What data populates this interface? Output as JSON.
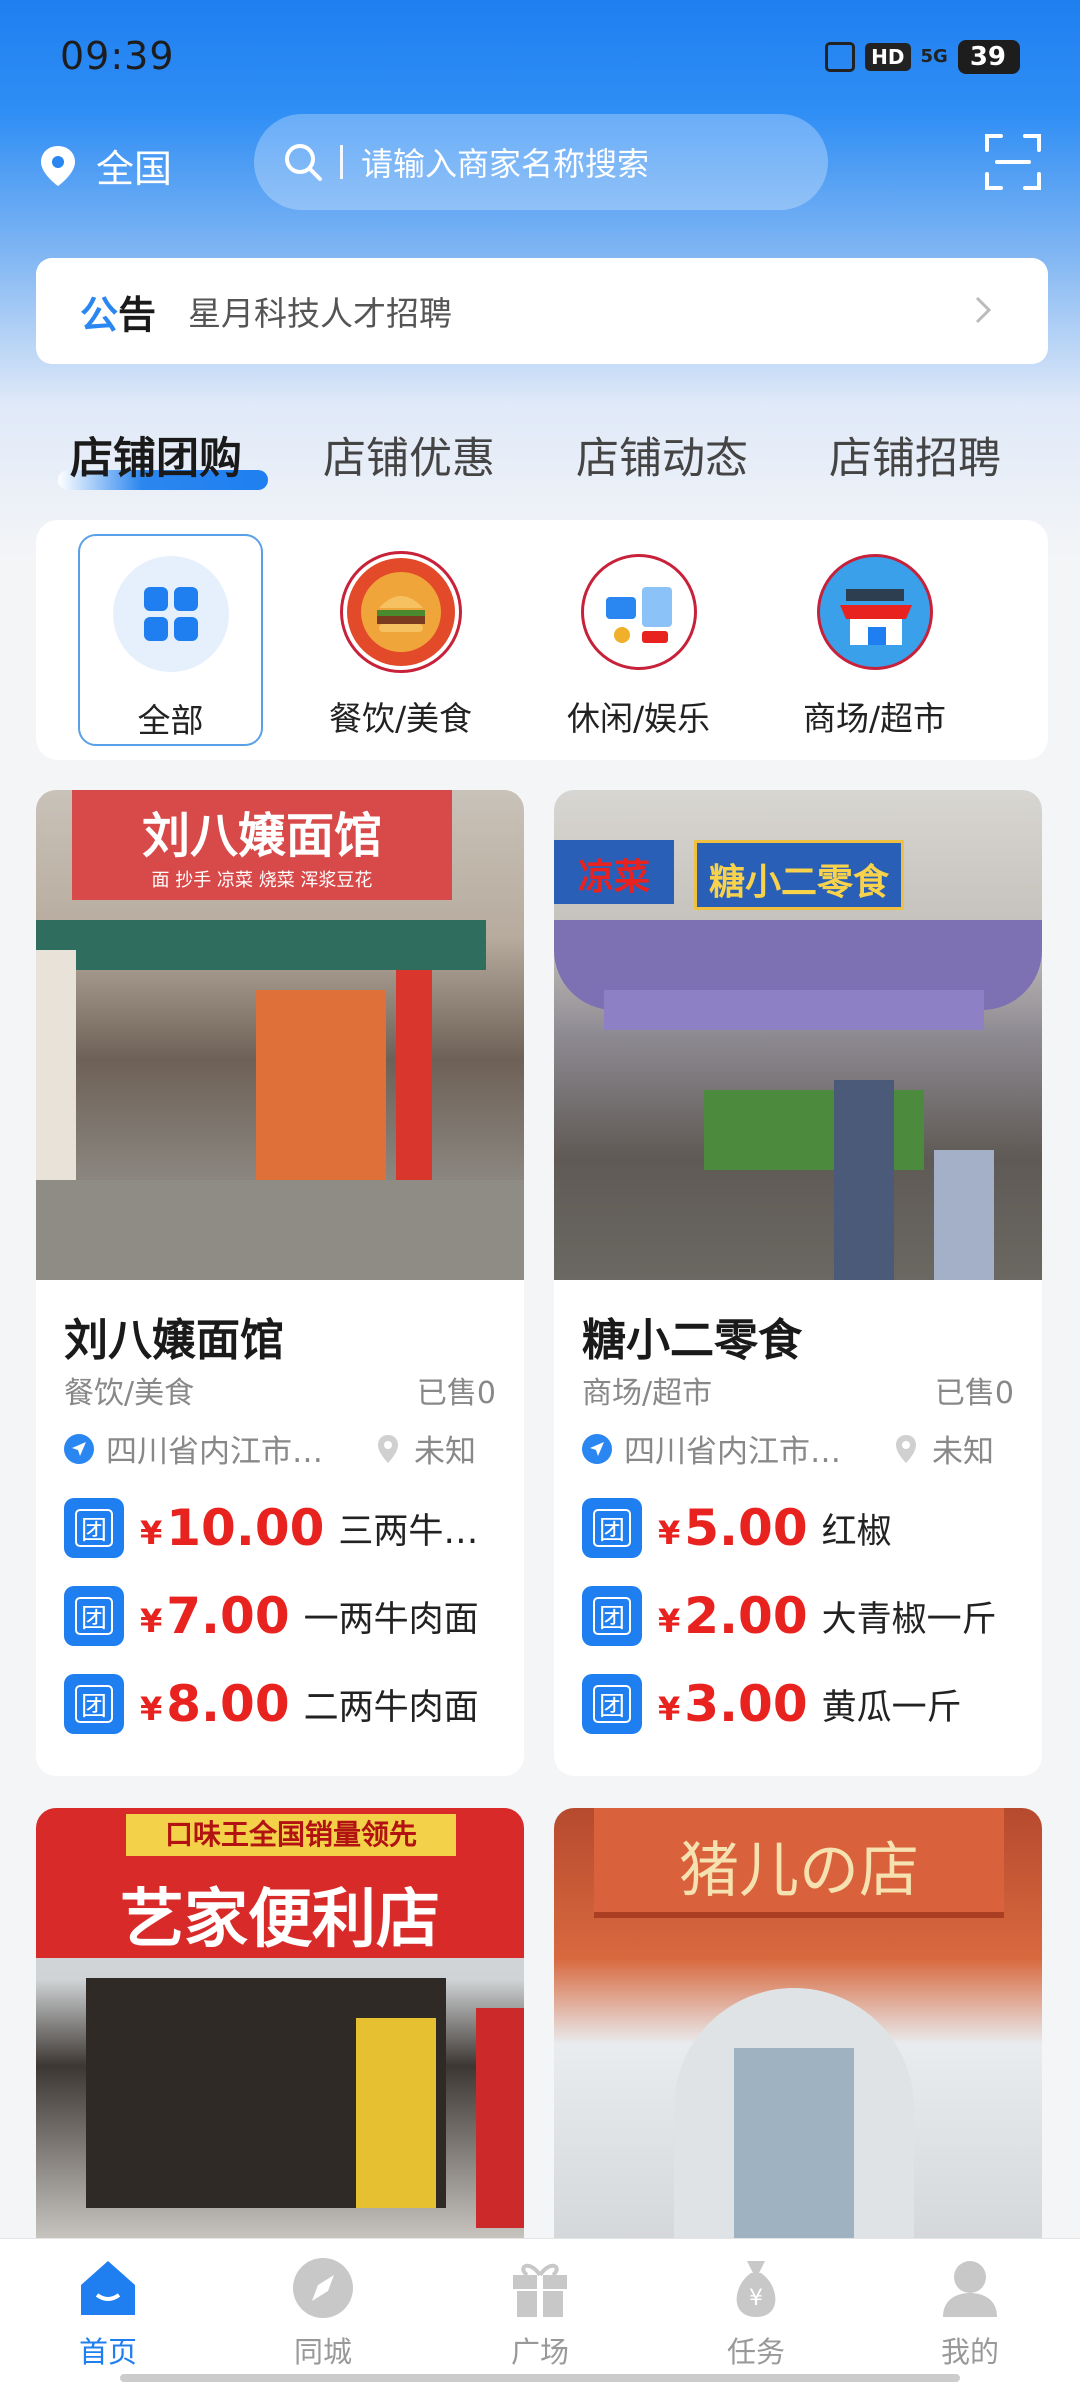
{
  "status": {
    "time": "09:39",
    "hd": "HD",
    "signal": "5G",
    "battery": "39"
  },
  "header": {
    "location": "全国",
    "search_placeholder": "请输入商家名称搜索",
    "notice_label_a": "公",
    "notice_label_b": "告",
    "notice_text": "星月科技人才招聘"
  },
  "tabs": [
    "店铺团购",
    "店铺优惠",
    "店铺动态",
    "店铺招聘"
  ],
  "categories": [
    "全部",
    "餐饮/美食",
    "休闲/娱乐",
    "商场/超市"
  ],
  "stores": [
    {
      "name": "刘八嬢面馆",
      "category": "餐饮/美食",
      "sold": "已售0",
      "address": "四川省内江市…",
      "distance": "未知",
      "sign": "刘八嬢面馆",
      "sign_sub": "面 抄手 凉菜 烧菜 浑浆豆花",
      "deals": [
        {
          "badge": "团",
          "currency": "¥",
          "price": "10.00",
          "name": "三两牛…"
        },
        {
          "badge": "团",
          "currency": "¥",
          "price": "7.00",
          "name": "一两牛肉面"
        },
        {
          "badge": "团",
          "currency": "¥",
          "price": "8.00",
          "name": "二两牛肉面"
        }
      ]
    },
    {
      "name": "糖小二零食",
      "category": "商场/超市",
      "sold": "已售0",
      "address": "四川省内江市…",
      "distance": "未知",
      "sign": "糖小二零食",
      "sign_side": "凉菜",
      "deals": [
        {
          "badge": "团",
          "currency": "¥",
          "price": "5.00",
          "name": "红椒"
        },
        {
          "badge": "团",
          "currency": "¥",
          "price": "2.00",
          "name": "大青椒一斤"
        },
        {
          "badge": "团",
          "currency": "¥",
          "price": "3.00",
          "name": "黄瓜一斤"
        }
      ]
    },
    {
      "sign_top": "口味王全国销量领先",
      "sign": "艺家便利店"
    },
    {
      "sign": "猪儿の店"
    }
  ],
  "bottom_nav": [
    "首页",
    "同城",
    "广场",
    "任务",
    "我的"
  ],
  "colors": {
    "primary": "#1f7ff0",
    "price": "#e8221f"
  }
}
